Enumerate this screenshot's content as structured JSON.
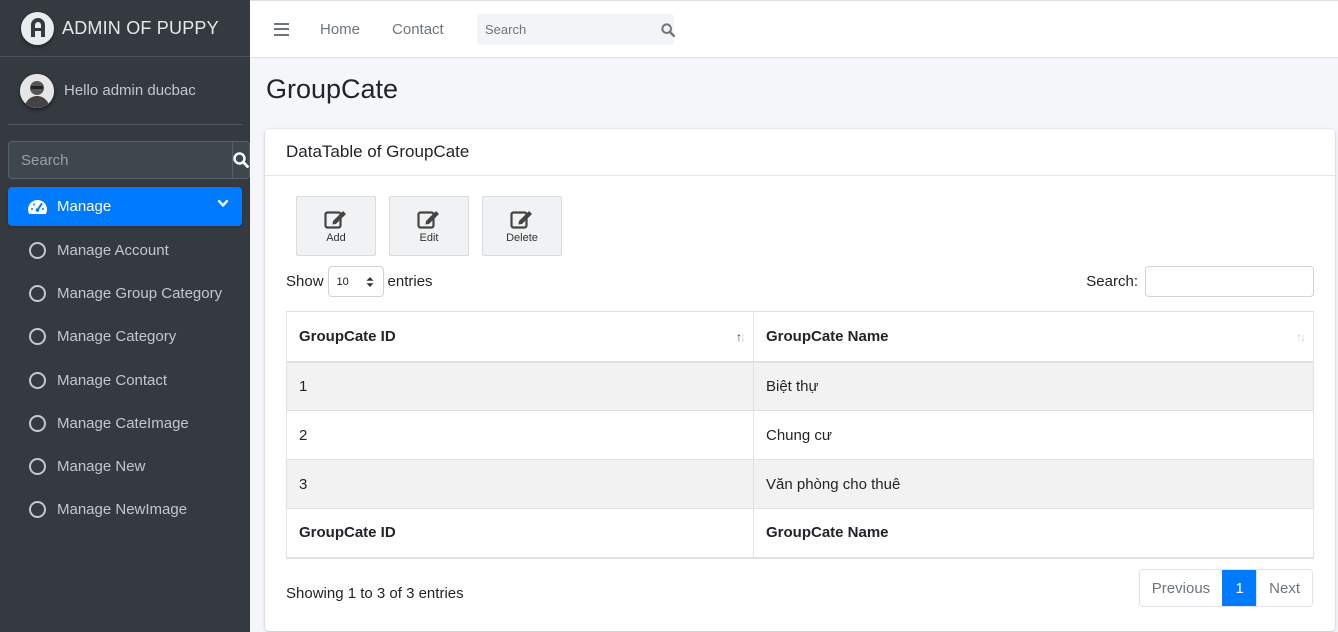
{
  "brand": {
    "name": "ADMIN OF PUPPY"
  },
  "user": {
    "greeting": "Hello admin ducbac"
  },
  "sidebar": {
    "search_placeholder": "Search",
    "active": {
      "label": "Manage",
      "icon": "tachometer-icon"
    },
    "items": [
      {
        "label": "Manage Account"
      },
      {
        "label": "Manage Group Category"
      },
      {
        "label": "Manage Category"
      },
      {
        "label": "Manage Contact"
      },
      {
        "label": "Manage CateImage"
      },
      {
        "label": "Manage New"
      },
      {
        "label": "Manage NewImage"
      }
    ]
  },
  "topnav": {
    "links": [
      "Home",
      "Contact"
    ],
    "search_placeholder": "Search"
  },
  "page": {
    "title": "GroupCate"
  },
  "card": {
    "title": "DataTable of GroupCate",
    "buttons": [
      "Add",
      "Edit",
      "Delete"
    ],
    "length": {
      "prefix": "Show",
      "value": "10",
      "suffix": "entries"
    },
    "search_label": "Search:",
    "table": {
      "columns": [
        "GroupCate ID",
        "GroupCate Name"
      ],
      "rows": [
        [
          "1",
          "Biệt thự"
        ],
        [
          "2",
          "Chung cư"
        ],
        [
          "3",
          "Văn phòng cho thuê"
        ]
      ]
    },
    "info": "Showing 1 to 3 of 3 entries",
    "pagination": {
      "previous": "Previous",
      "current": "1",
      "next": "Next"
    }
  },
  "colors": {
    "accent": "#007bff",
    "sidebar_bg": "#343a40"
  }
}
